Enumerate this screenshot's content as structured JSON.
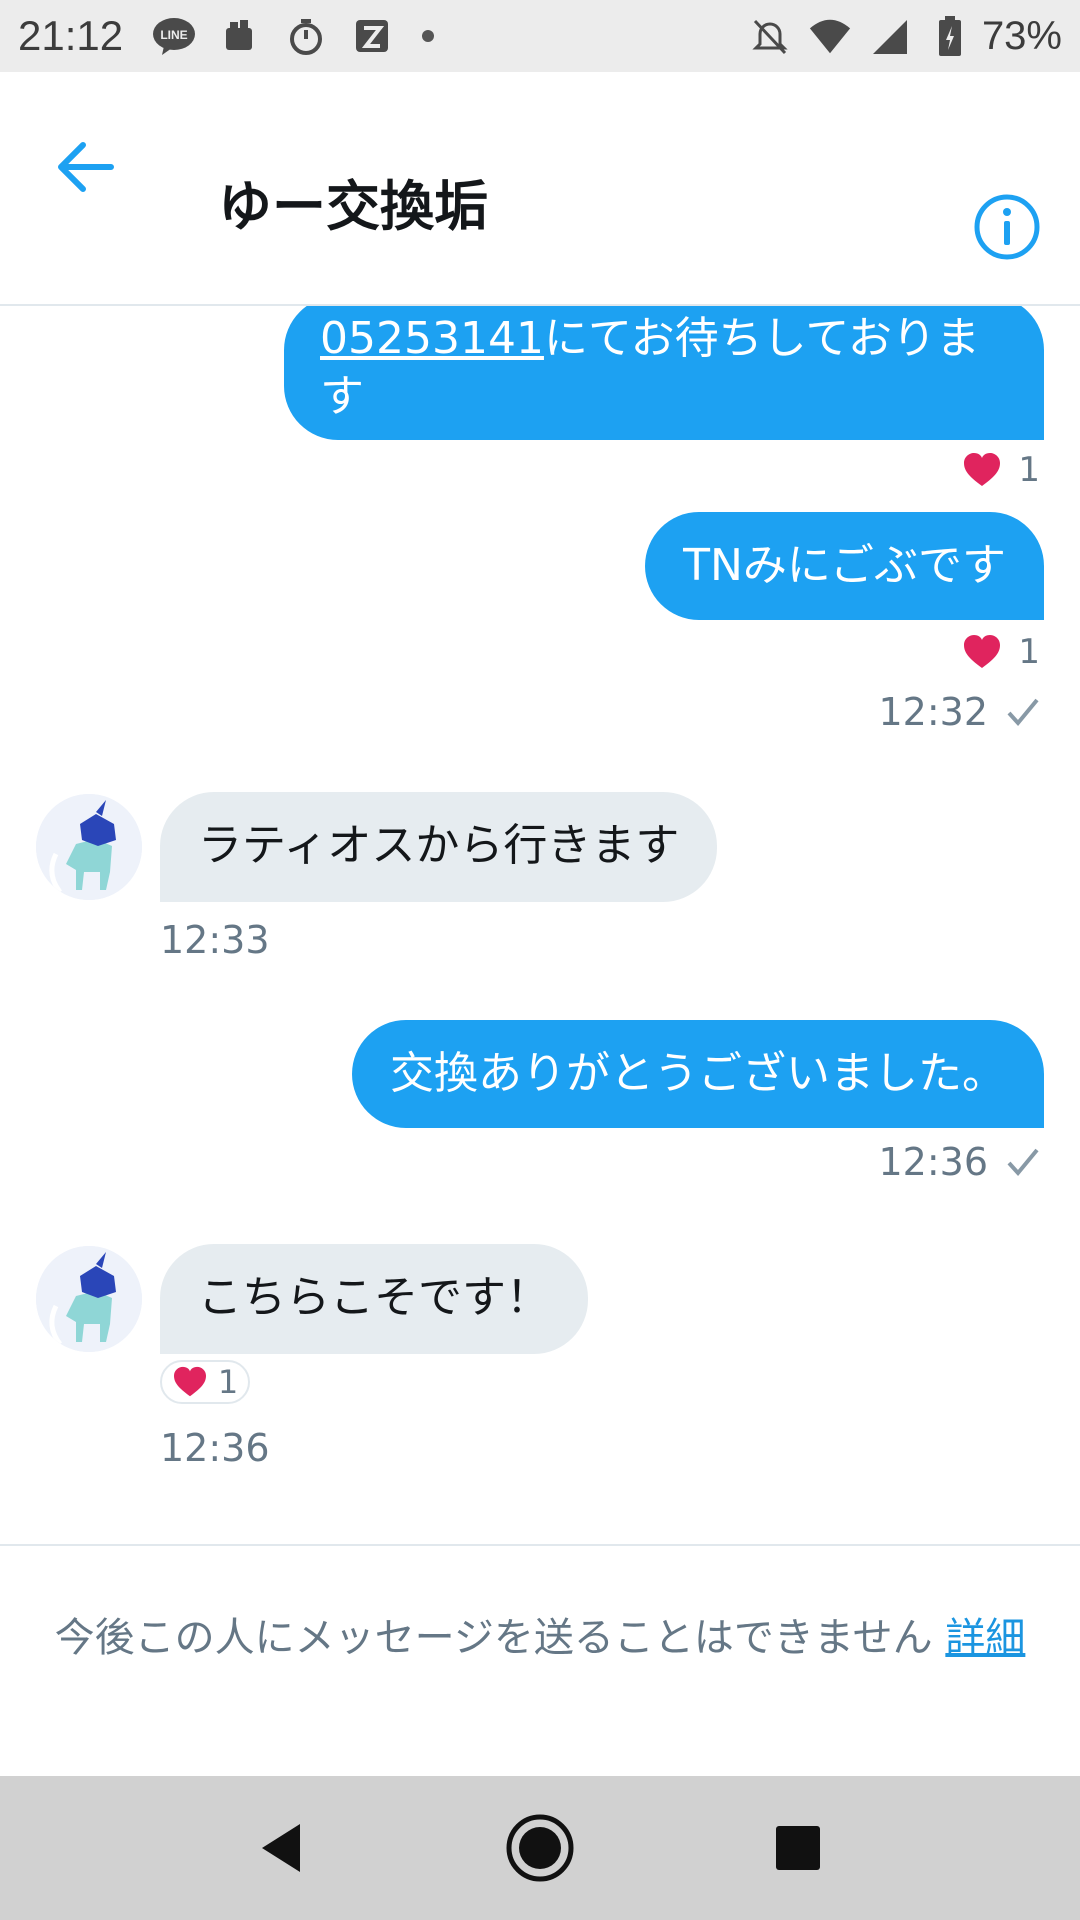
{
  "status_bar": {
    "time": "21:12",
    "battery": "73%",
    "icons": [
      "line-icon",
      "notification-icon",
      "timer-icon",
      "app-icon",
      "dot-icon",
      "mute-icon",
      "wifi-icon",
      "signal-icon",
      "battery-icon"
    ]
  },
  "header": {
    "title": "ゆー交換垢",
    "back_icon": "arrow-left-icon",
    "info_icon": "info-icon"
  },
  "messages": [
    {
      "direction": "out",
      "link": "05253141",
      "text": "にてお待ちしておりま",
      "text2": "す",
      "reaction_count": "1"
    },
    {
      "direction": "out",
      "text": "TNみにごぶです",
      "reaction_count": "1",
      "time": "12:32"
    },
    {
      "direction": "in",
      "text": "ラティオスから行きます",
      "time": "12:33"
    },
    {
      "direction": "out",
      "text": "交換ありがとうございました。",
      "time": "12:36"
    },
    {
      "direction": "in",
      "text": "こちらこそです！",
      "reaction_count": "1",
      "time": "12:36"
    }
  ],
  "footer": {
    "notice": "今後この人にメッセージを送ることはできません",
    "link": "詳細"
  },
  "colors": {
    "accent": "#1da1f2",
    "bubble_in": "#e6ecf0",
    "heart": "#e0245e",
    "muted": "#657786"
  }
}
